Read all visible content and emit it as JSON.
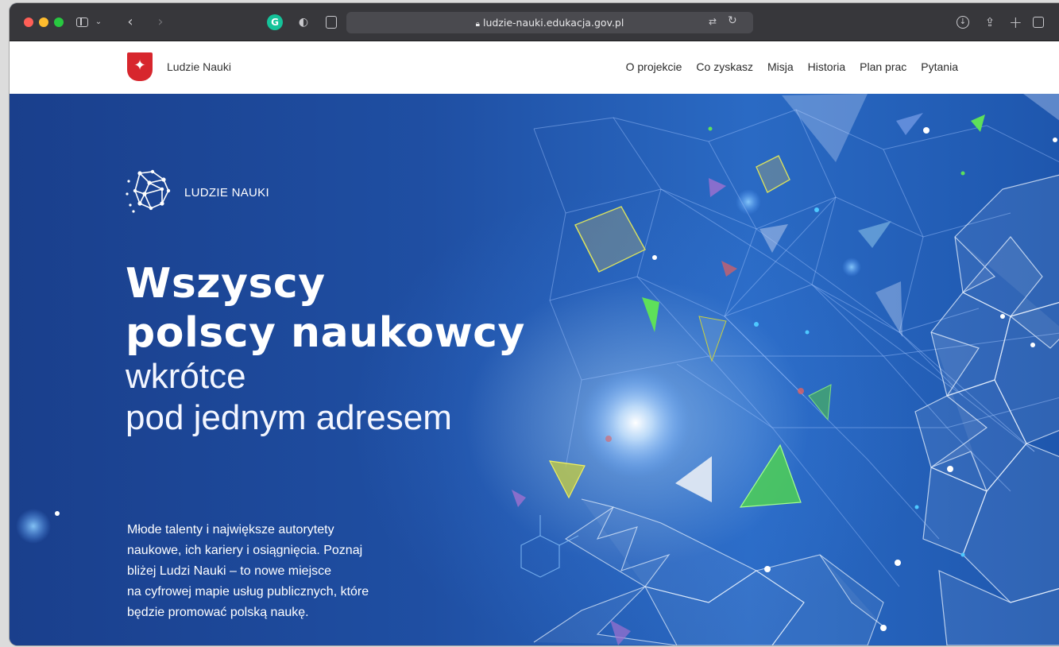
{
  "browser": {
    "url": "ludzie-nauki.edukacja.gov.pl",
    "icons": [
      "sidebar-icon",
      "chevron-down-icon",
      "back-icon",
      "forward-icon",
      "grammarly-icon",
      "privacy-shield-icon",
      "reader-icon",
      "lock-icon",
      "translate-icon",
      "reload-icon",
      "download-icon",
      "share-icon",
      "new-tab-icon",
      "tab-overview-icon"
    ]
  },
  "site": {
    "name": "Ludzie Nauki",
    "nav": [
      "O projekcie",
      "Co zyskasz",
      "Misja",
      "Historia",
      "Plan prac",
      "Pytania"
    ]
  },
  "hero": {
    "brand": "LUDZIE NAUKI",
    "headline_bold_1": "Wszyscy",
    "headline_bold_2": "polscy naukowcy",
    "headline_light_1": "wkrótce",
    "headline_light_2": "pod jednym adresem",
    "lede_lines": [
      "Młode talenty i największe autorytety",
      "naukowe, ich kariery i osiągnięcia. Poznaj",
      "bliżej Ludzi Nauki – to nowe miejsce",
      "na cyfrowej mapie usług publicznych, które",
      "będzie promować polską naukę."
    ]
  },
  "colors": {
    "brand_red": "#d7262d",
    "hero_blue": "#1f4fa3",
    "toolbar": "#37373b"
  }
}
